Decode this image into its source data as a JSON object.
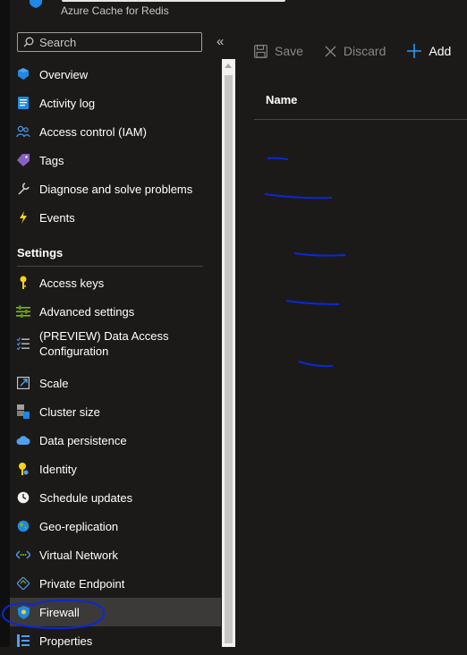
{
  "resource": {
    "subtitle": "Azure Cache for Redis"
  },
  "search": {
    "placeholder": "Search"
  },
  "collapse_icon": "«",
  "nav": {
    "items": [
      {
        "label": "Overview",
        "icon": "overview-icon"
      },
      {
        "label": "Activity log",
        "icon": "activity-log-icon"
      },
      {
        "label": "Access control (IAM)",
        "icon": "people-icon"
      },
      {
        "label": "Tags",
        "icon": "tag-icon"
      },
      {
        "label": "Diagnose and solve problems",
        "icon": "wrench-icon"
      },
      {
        "label": "Events",
        "icon": "lightning-icon"
      }
    ],
    "settings_header": "Settings",
    "settings_items": [
      {
        "label": "Access keys",
        "icon": "key-icon"
      },
      {
        "label": "Advanced settings",
        "icon": "settings-sliders-icon"
      },
      {
        "label": "(PREVIEW) Data Access Configuration",
        "label_line1": "(PREVIEW) Data Access",
        "label_line2": "Configuration",
        "icon": "list-check-icon"
      },
      {
        "label": "Scale",
        "icon": "scale-icon"
      },
      {
        "label": "Cluster size",
        "icon": "cluster-icon"
      },
      {
        "label": "Data persistence",
        "icon": "cloud-icon"
      },
      {
        "label": "Identity",
        "icon": "identity-icon"
      },
      {
        "label": "Schedule updates",
        "icon": "clock-icon"
      },
      {
        "label": "Geo-replication",
        "icon": "globe-icon"
      },
      {
        "label": "Virtual Network",
        "icon": "vnet-icon"
      },
      {
        "label": "Private Endpoint",
        "icon": "private-endpoint-icon"
      },
      {
        "label": "Firewall",
        "icon": "firewall-shield-icon",
        "active": true
      },
      {
        "label": "Properties",
        "icon": "properties-icon"
      }
    ]
  },
  "toolbar": {
    "save_label": "Save",
    "discard_label": "Discard",
    "add_label": "Add"
  },
  "grid": {
    "name_header": "Name"
  },
  "colors": {
    "background": "#1b1a19",
    "accent": "#0078d4",
    "scribble": "#0b28d6"
  }
}
